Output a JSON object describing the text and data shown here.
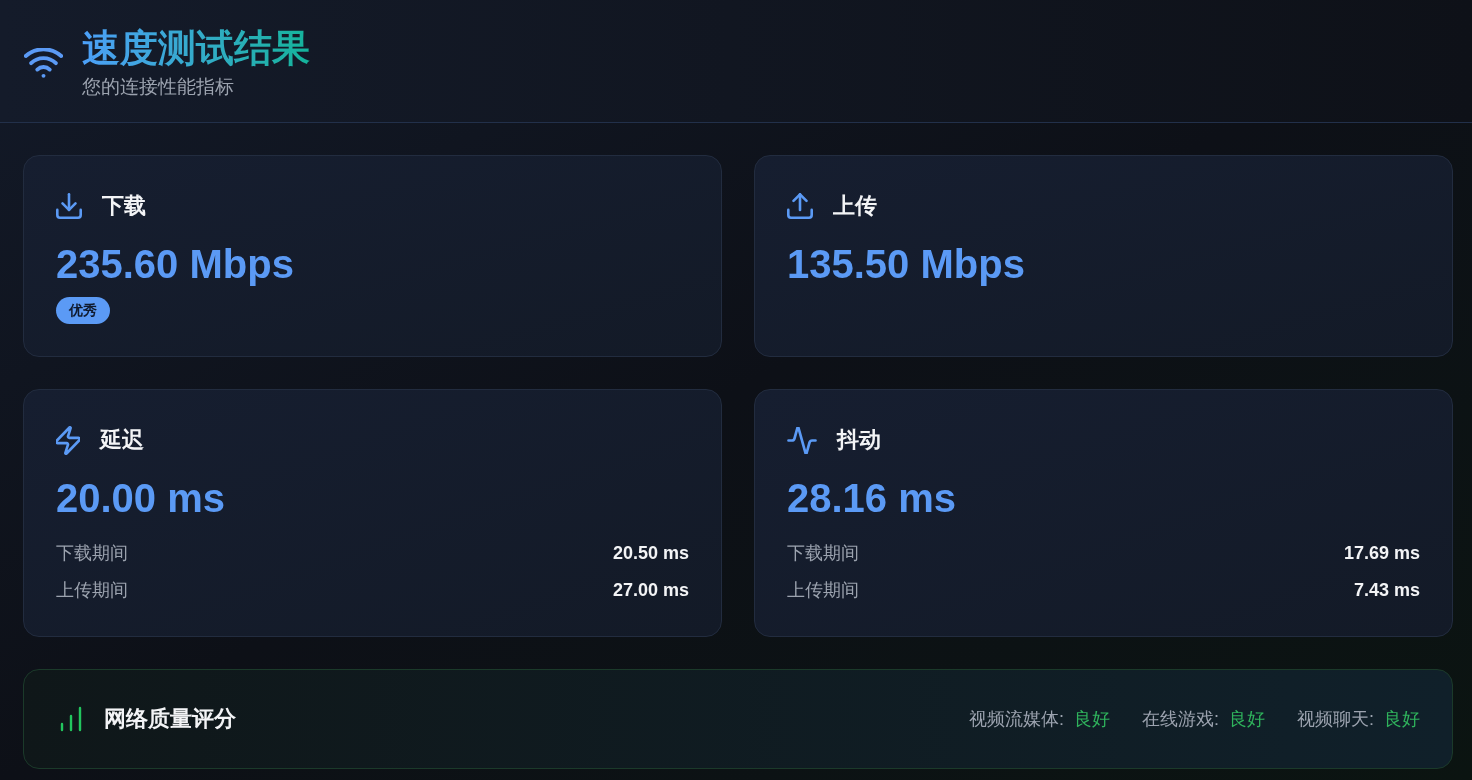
{
  "header": {
    "title": "速度测试结果",
    "subtitle": "您的连接性能指标"
  },
  "metrics": [
    {
      "kind": "download",
      "title": "下载",
      "value": "235.60 Mbps",
      "badge": "优秀"
    },
    {
      "kind": "upload",
      "title": "上传",
      "value": "135.50 Mbps"
    },
    {
      "kind": "latency",
      "title": "延迟",
      "value": "20.00 ms",
      "details": [
        {
          "label": "下载期间",
          "value": "20.50 ms"
        },
        {
          "label": "上传期间",
          "value": "27.00 ms"
        }
      ]
    },
    {
      "kind": "jitter",
      "title": "抖动",
      "value": "28.16 ms",
      "details": [
        {
          "label": "下载期间",
          "value": "17.69 ms"
        },
        {
          "label": "上传期间",
          "value": "7.43 ms"
        }
      ]
    }
  ],
  "quality": {
    "title": "网络质量评分",
    "items": [
      {
        "label": "视频流媒体:",
        "value": "良好"
      },
      {
        "label": "在线游戏:",
        "value": "良好"
      },
      {
        "label": "视频聊天:",
        "value": "良好"
      }
    ]
  }
}
